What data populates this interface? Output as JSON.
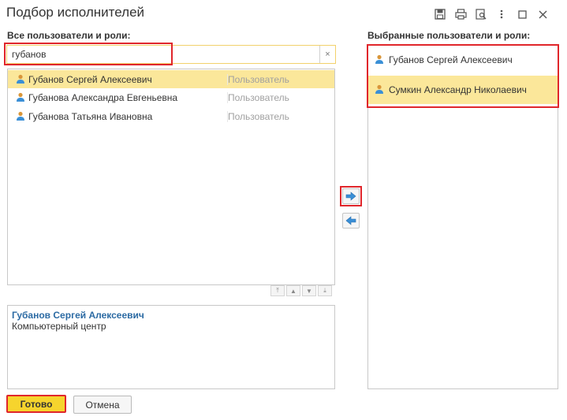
{
  "window": {
    "title": "Подбор исполнителей",
    "toolbar_icons": [
      "save-icon",
      "print-icon",
      "preview-icon",
      "more-icon",
      "maximize-icon",
      "close-icon"
    ],
    "toolbar_glyphs": [
      "💾",
      "🖶",
      "🔍",
      "⋮",
      "☐",
      "✕"
    ]
  },
  "left": {
    "label": "Все пользователи и роли:",
    "search": {
      "value": "губанов",
      "clear_glyph": "×"
    },
    "rows": [
      {
        "name": "Губанов Сергей Алексеевич",
        "type": "Пользователь",
        "selected": true
      },
      {
        "name": "Губанова Александра Евгеньевна",
        "type": "Пользователь",
        "selected": false
      },
      {
        "name": "Губанова Татьяна Ивановна",
        "type": "Пользователь",
        "selected": false
      }
    ],
    "sort_buttons": [
      "⤒",
      "▲",
      "▼",
      "⤓"
    ]
  },
  "detail": {
    "name": "Губанов Сергей Алексеевич",
    "org": "Компьютерный центр"
  },
  "right": {
    "label": "Выбранные пользователи и роли:",
    "rows": [
      {
        "name": "Губанов Сергей Алексеевич",
        "selected": false
      },
      {
        "name": "Сумкин Александр Николаевич",
        "selected": true
      }
    ]
  },
  "buttons": {
    "done": "Готово",
    "cancel": "Отмена"
  },
  "colors": {
    "selection": "#fbe79a",
    "highlight_border": "#e0262b",
    "primary_button": "#f6d42d",
    "link_blue": "#2b6aa3",
    "arrow_blue": "#3a8fd6"
  }
}
